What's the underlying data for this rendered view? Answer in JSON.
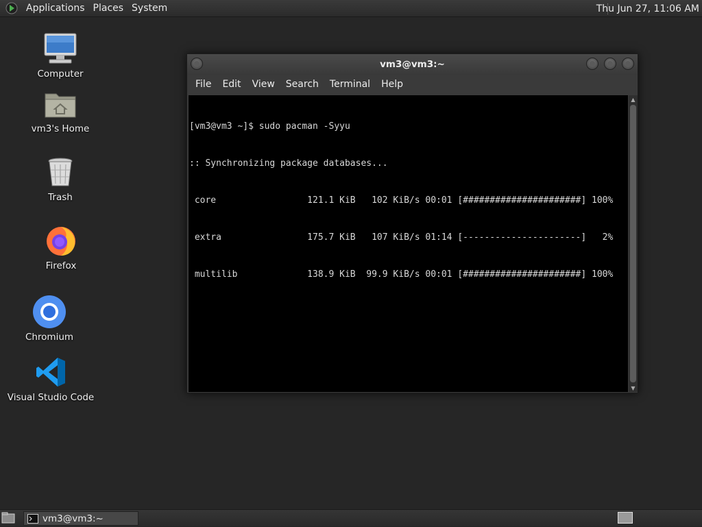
{
  "top_panel": {
    "menus": [
      "Applications",
      "Places",
      "System"
    ],
    "clock": "Thu Jun 27, 11:06 AM"
  },
  "desktop_icons": [
    {
      "label": "Computer",
      "icon": "computer-icon"
    },
    {
      "label": "vm3's Home",
      "icon": "home-folder-icon"
    },
    {
      "label": "Trash",
      "icon": "trash-icon"
    },
    {
      "label": "Firefox",
      "icon": "firefox-icon"
    },
    {
      "label": "Chromium",
      "icon": "chromium-icon"
    },
    {
      "label": "Visual Studio Code",
      "icon": "vscode-icon"
    }
  ],
  "terminal": {
    "title": "vm3@vm3:~",
    "menu": [
      "File",
      "Edit",
      "View",
      "Search",
      "Terminal",
      "Help"
    ],
    "lines": [
      "[vm3@vm3 ~]$ sudo pacman -Syyu",
      ":: Synchronizing package databases...",
      " core                 121.1 KiB   102 KiB/s 00:01 [######################] 100%",
      " extra                175.7 KiB   107 KiB/s 01:14 [----------------------]   2%",
      " multilib             138.9 KiB  99.9 KiB/s 00:01 [######################] 100%"
    ]
  },
  "taskbar": {
    "task_label": "vm3@vm3:~"
  },
  "colors": {
    "desktop_bg": "#262626",
    "terminal_bg": "#000000",
    "terminal_fg": "#d8d8d8"
  }
}
